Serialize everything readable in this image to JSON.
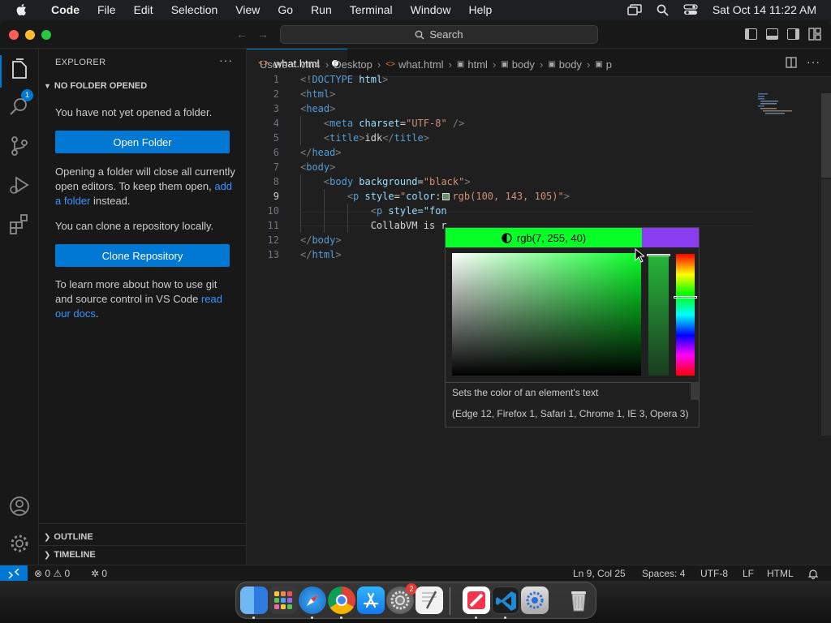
{
  "menubar": {
    "app": "Code",
    "items": [
      "File",
      "Edit",
      "Selection",
      "View",
      "Go",
      "Run",
      "Terminal",
      "Window",
      "Help"
    ],
    "clock": "Sat Oct 14  11:22 AM"
  },
  "titlebar": {
    "search_label": "Search"
  },
  "activity": {
    "explorer_badge": "1"
  },
  "sidebar": {
    "title": "EXPLORER",
    "more": "···",
    "section": "NO FOLDER OPENED",
    "msg1": "You have not yet opened a folder.",
    "open_folder": "Open Folder",
    "msg2_a": "Opening a folder will close all currently open editors. To keep them open, ",
    "msg2_link": "add a folder",
    "msg2_b": " instead.",
    "msg3": "You can clone a repository locally.",
    "clone_repo": "Clone Repository",
    "msg4_a": "To learn more about how to use git and source control in VS Code ",
    "msg4_link": "read our docs",
    "msg4_b": ".",
    "outline": "OUTLINE",
    "timeline": "TIMELINE"
  },
  "tab": {
    "label": "what.html"
  },
  "breadcrumbs": [
    "Users",
    "vm4",
    "Desktop",
    "what.html",
    "html",
    "body",
    "body",
    "p"
  ],
  "code": {
    "line_numbers": [
      "1",
      "2",
      "3",
      "4",
      "5",
      "6",
      "7",
      "8",
      "9",
      "10",
      "11",
      "12",
      "13"
    ],
    "line9_text": "rgb(100, 143, 105)",
    "line10_partial": "style=\"fon",
    "line11_partial": "CollabVM is r"
  },
  "picker": {
    "color_label": "rgb(7, 255, 40)",
    "new_color": "#07ff28",
    "original_color": "#8a3df0",
    "desc": "Sets the color of an element's text",
    "compat": "(Edge 12, Firefox 1, Safari 1, Chrome 1, IE 3, Opera 3)"
  },
  "status": {
    "errors": "0",
    "warnings": "0",
    "ports": "0",
    "cursor": "Ln 9, Col 25",
    "spaces": "Spaces: 4",
    "encoding": "UTF-8",
    "eol": "LF",
    "language": "HTML"
  },
  "dock": {
    "settings_badge": "2"
  },
  "colors": {
    "accent": "#0078d4",
    "link": "#3794ff"
  }
}
